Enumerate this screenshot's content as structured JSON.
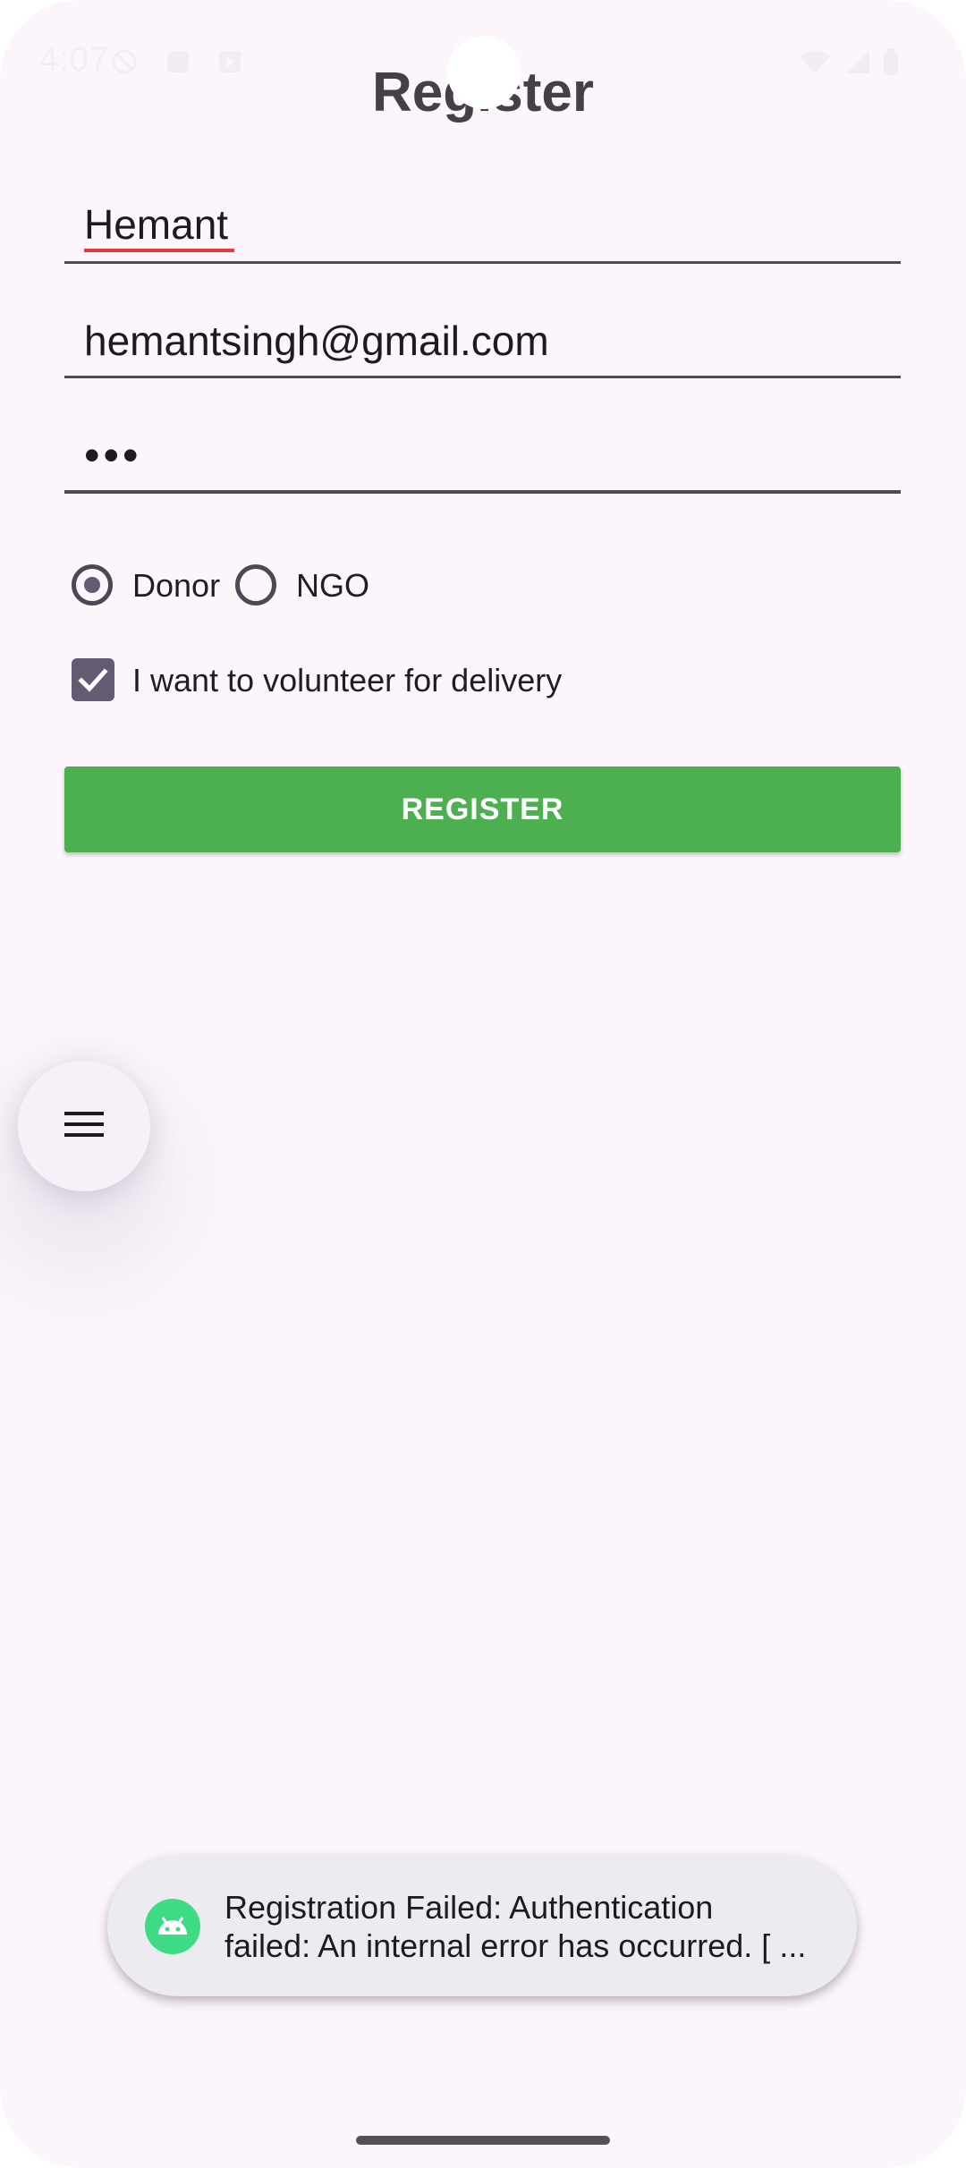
{
  "status_bar": {
    "time": "4:07"
  },
  "page": {
    "title": "Register"
  },
  "form": {
    "name_value": "Hemant",
    "email_value": "hemantsingh@gmail.com",
    "password_masked": "•••",
    "role_options": [
      {
        "label": "Donor",
        "selected": true
      },
      {
        "label": "NGO",
        "selected": false
      }
    ],
    "volunteer_label": "I want to volunteer for delivery",
    "volunteer_checked": true,
    "register_label": "REGISTER"
  },
  "toast": {
    "line1": "Registration Failed: Authentication",
    "line2": "failed: An internal error has occurred. [ ..."
  },
  "colors": {
    "background": "#fcf5fb",
    "accent": "#625b71",
    "button": "#4caf50",
    "spellcheck_underline": "#e63b3b",
    "android_green": "#3ddc84"
  },
  "icons": {
    "menu_fab": "hamburger-menu-icon",
    "toast": "android-icon"
  }
}
